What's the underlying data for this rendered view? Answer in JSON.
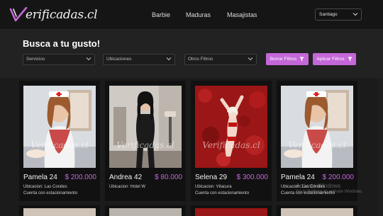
{
  "brand": {
    "logo_text": "erificadas.cl",
    "accent": "#c467d8"
  },
  "nav": {
    "items": [
      "Barbie",
      "Maduras",
      "Masajistas"
    ]
  },
  "city_select": {
    "value": "Santiago"
  },
  "hero": {
    "title": "Busca a tu gusto!",
    "filters": [
      "Servicios",
      "Ubicaciones",
      "Otros Filtros"
    ],
    "clear_label": "Borrar Filtros",
    "apply_label": "Aplicar Filtros"
  },
  "listings": [
    {
      "name": "Pamela 24",
      "price": "$ 200.000",
      "location": "Ubicacion: Las Condes",
      "parking": "Cuenta con estacionamiento"
    },
    {
      "name": "Andrea 42",
      "price": "$ 80.000",
      "location": "Ubicacion: Hotel W",
      "parking": ""
    },
    {
      "name": "Selena 29",
      "price": "$ 300.000",
      "location": "Ubicacion: Vitacura",
      "parking": "Cuenta con estacionamiento"
    },
    {
      "name": "Pamela 24",
      "price": "$ 200.000",
      "location": "Ubicacion: Las Condes",
      "parking": "Cuenta con estacionamiento"
    }
  ],
  "watermark": {
    "photo": "Verificadas.cl",
    "os_line1": "Activate Windows",
    "os_line2": "Go to Settings to activate Windows."
  },
  "icons": {
    "chevron": "chevron-down-icon",
    "filter": "filter-icon",
    "logo": "v-check-icon"
  }
}
